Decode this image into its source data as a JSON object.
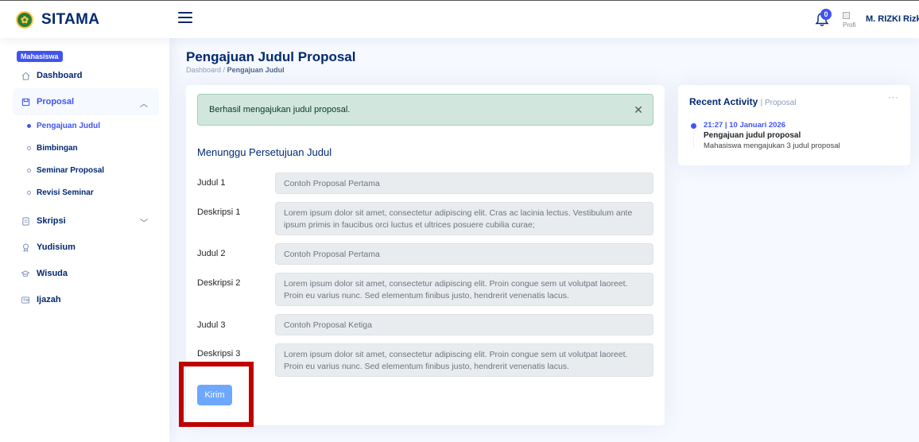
{
  "app": {
    "name": "SITAMA"
  },
  "header": {
    "notification_count": "0",
    "avatar_alt": "Profi",
    "user_name": "M. RIZKI Rizki"
  },
  "sidebar": {
    "role": "Mahasiswa",
    "items": [
      {
        "label": "Dashboard",
        "icon": "home-icon"
      },
      {
        "label": "Proposal",
        "icon": "proposal-icon",
        "expanded": true
      },
      {
        "label": "Skripsi",
        "icon": "document-icon",
        "expanded": false
      },
      {
        "label": "Yudisium",
        "icon": "award-icon"
      },
      {
        "label": "Wisuda",
        "icon": "graduation-icon"
      },
      {
        "label": "Ijazah",
        "icon": "certificate-icon"
      }
    ],
    "proposal_sub": [
      {
        "label": "Pengajuan Judul",
        "active": true
      },
      {
        "label": "Bimbingan"
      },
      {
        "label": "Seminar Proposal"
      },
      {
        "label": "Revisi Seminar"
      }
    ]
  },
  "page": {
    "title": "Pengajuan Judul Proposal",
    "breadcrumb_root": "Dashboard",
    "breadcrumb_sep": "/",
    "breadcrumb_current": "Pengajuan Judul"
  },
  "alert": {
    "message": "Berhasil mengajukan judul proposal."
  },
  "form": {
    "section_title": "Menunggu Persetujuan Judul",
    "fields": [
      {
        "label": "Judul 1",
        "value": "Contoh Proposal Pertama"
      },
      {
        "label": "Deskripsi 1",
        "value": "Lorem ipsum dolor sit amet, consectetur adipiscing elit. Cras ac lacinia lectus. Vestibulum ante ipsum primis in faucibus orci luctus et ultrices posuere cubilia curae;"
      },
      {
        "label": "Judul 2",
        "value": "Contoh Proposal Pertama"
      },
      {
        "label": "Deskripsi 2",
        "value": "Lorem ipsum dolor sit amet, consectetur adipiscing elit. Proin congue sem ut volutpat laoreet. Proin eu varius nunc. Sed elementum finibus justo, hendrerit venenatis lacus."
      },
      {
        "label": "Judul 3",
        "value": "Contoh Proposal Ketiga"
      },
      {
        "label": "Deskripsi 3",
        "value": "Lorem ipsum dolor sit amet, consectetur adipiscing elit. Proin congue sem ut volutpat laoreet. Proin eu varius nunc. Sed elementum finibus justo, hendrerit venenatis lacus."
      }
    ],
    "submit_label": "Kirim"
  },
  "activity": {
    "title": "Recent Activity",
    "subtitle": "| Proposal",
    "items": [
      {
        "time": "21:27 | 10 Januari 2026",
        "heading": "Pengajuan judul proposal",
        "description": "Mahasiswa mengajukan 3 judul proposal"
      }
    ]
  },
  "colors": {
    "primary": "#4154f1",
    "navy": "#012970",
    "highlight": "#c00000",
    "success_bg": "#d1e7dd"
  }
}
